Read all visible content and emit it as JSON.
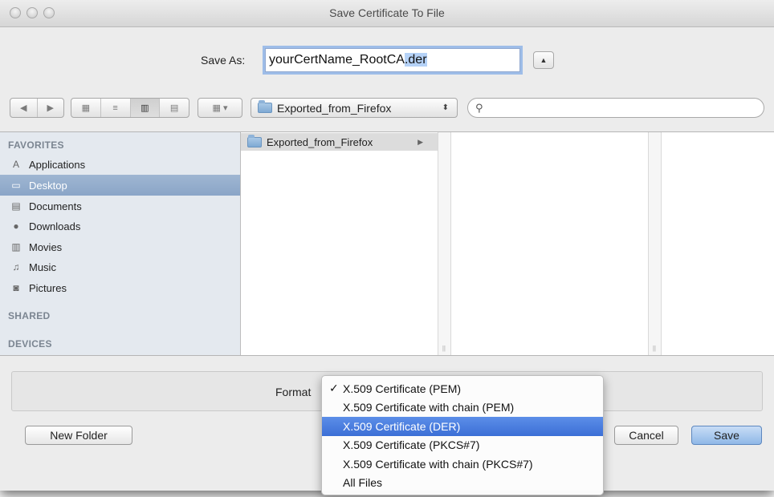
{
  "window": {
    "title": "Save Certificate To File"
  },
  "save_as": {
    "label": "Save As:",
    "filename_base": "yourCertName_RootCA",
    "filename_ext": ".der",
    "expand_glyph": "▲"
  },
  "toolbar": {
    "back_glyph": "◀",
    "forward_glyph": "▶",
    "view_icons_glyph": "▦",
    "view_list_glyph": "≡",
    "view_columns_glyph": "▥",
    "view_coverflow_glyph": "▤",
    "arrange_glyph": "▦ ▾",
    "location": "Exported_from_Firefox",
    "location_arrows": "⬍",
    "search_glyph": "⚲",
    "search_value": ""
  },
  "sidebar": {
    "favorites_header": "FAVORITES",
    "items": [
      {
        "label": "Applications",
        "icon": "applications-icon",
        "glyph": "A"
      },
      {
        "label": "Desktop",
        "icon": "desktop-icon",
        "glyph": "▭",
        "selected": true
      },
      {
        "label": "Documents",
        "icon": "documents-icon",
        "glyph": "▤"
      },
      {
        "label": "Downloads",
        "icon": "downloads-icon",
        "glyph": "●"
      },
      {
        "label": "Movies",
        "icon": "movies-icon",
        "glyph": "▥"
      },
      {
        "label": "Music",
        "icon": "music-icon",
        "glyph": "♫"
      },
      {
        "label": "Pictures",
        "icon": "pictures-icon",
        "glyph": "◙"
      }
    ],
    "shared_header": "SHARED",
    "devices_header": "DEVICES"
  },
  "columns": {
    "col1_items": [
      {
        "label": "Exported_from_Firefox",
        "arrow": "▶"
      }
    ],
    "grip_glyph": "||"
  },
  "format": {
    "label": "Format",
    "check_glyph": "✓",
    "options": [
      {
        "label": "X.509 Certificate (PEM)",
        "checked": true
      },
      {
        "label": "X.509 Certificate with chain (PEM)"
      },
      {
        "label": "X.509 Certificate (DER)",
        "highlighted": true
      },
      {
        "label": "X.509 Certificate (PKCS#7)"
      },
      {
        "label": "X.509 Certificate with chain (PKCS#7)"
      },
      {
        "label": "All Files"
      }
    ]
  },
  "buttons": {
    "new_folder": "New Folder",
    "cancel": "Cancel",
    "save": "Save"
  },
  "colors": {
    "selection_blue": "#3c6fd6",
    "sidebar_bg": "#e4e9ef",
    "sidebar_selected": "#8aa5c7"
  }
}
